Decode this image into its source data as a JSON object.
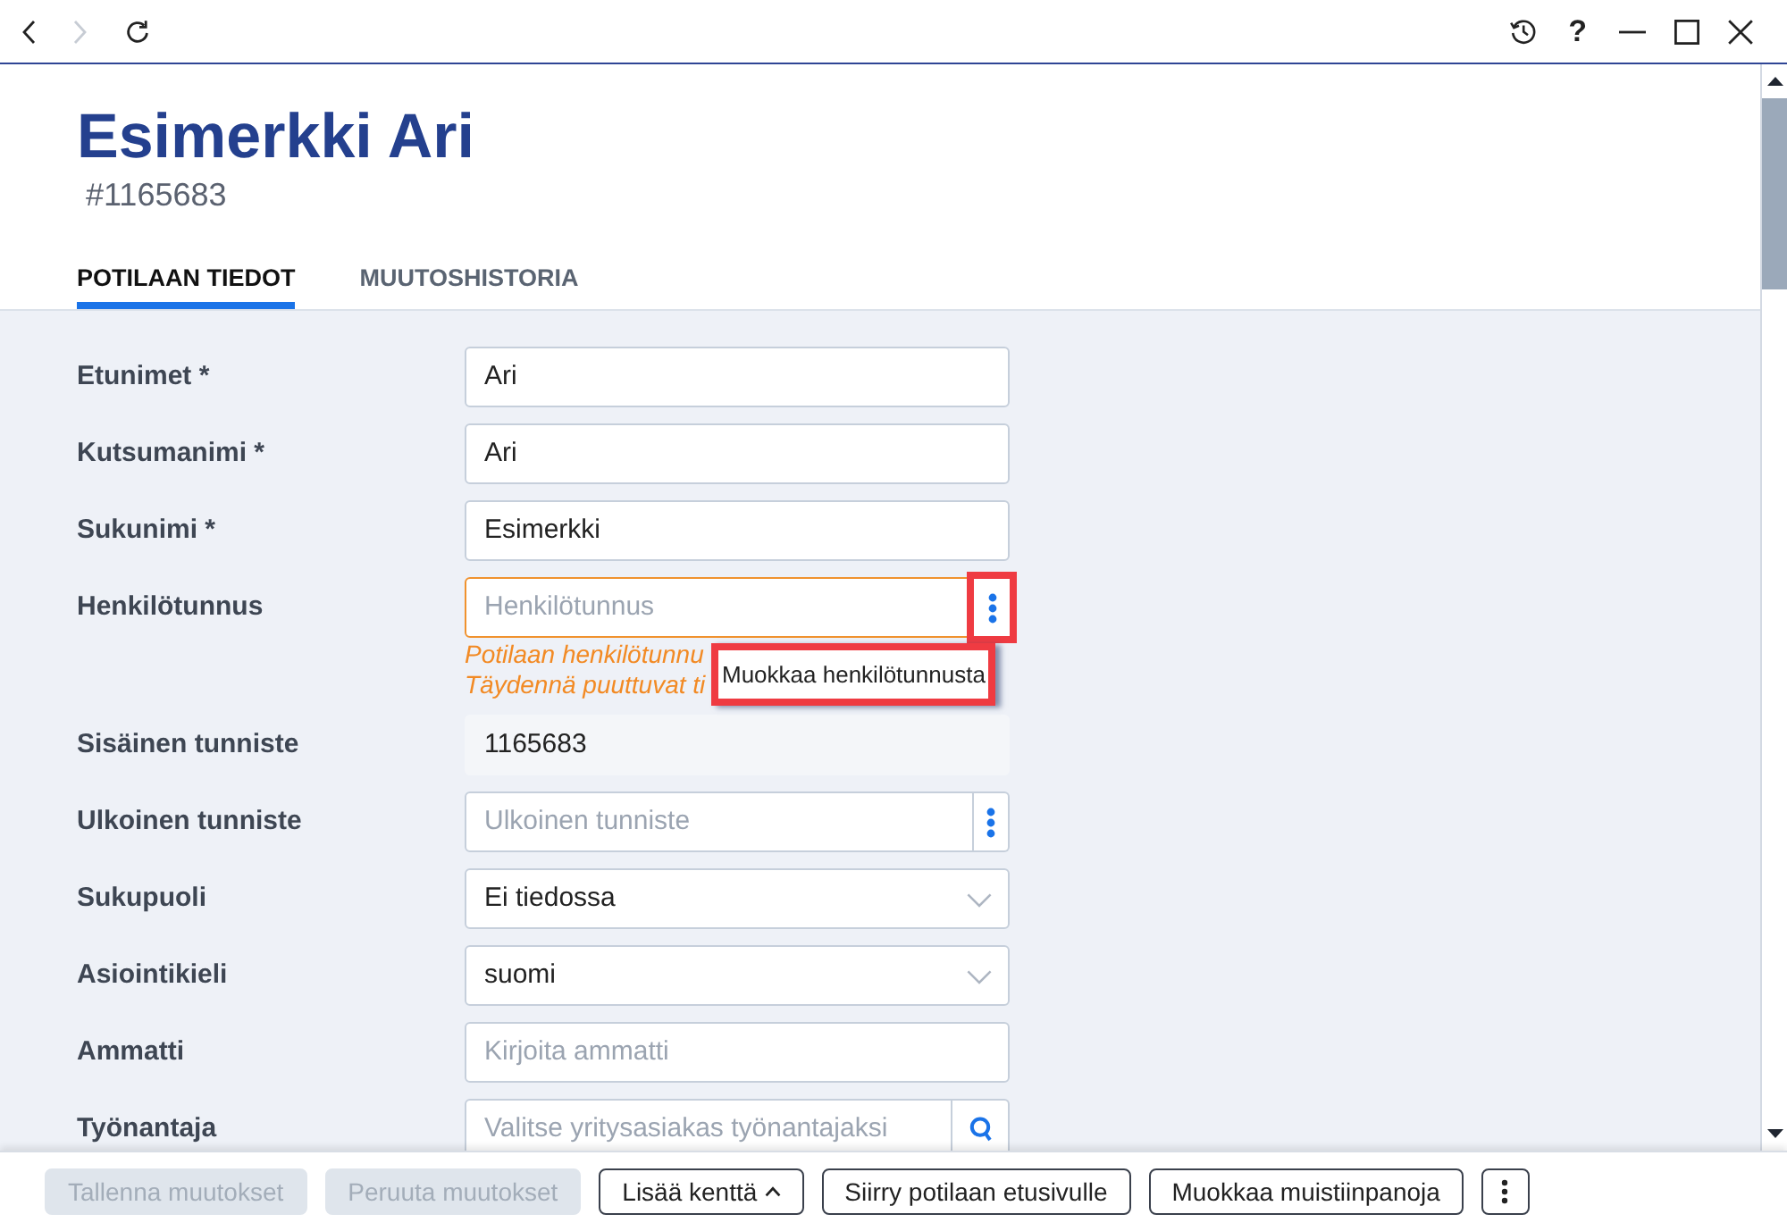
{
  "nav_buttons": [
    {
      "kind": "back",
      "disabled": false
    },
    {
      "kind": "forward",
      "disabled": true
    },
    {
      "kind": "reload",
      "disabled": false
    }
  ],
  "window_controls": [
    {
      "kind": "history"
    },
    {
      "kind": "help",
      "label": "?"
    },
    {
      "kind": "minimize"
    },
    {
      "kind": "maximize"
    },
    {
      "kind": "close"
    }
  ],
  "patient": {
    "name": "Esimerkki Ari",
    "number": "#1165683"
  },
  "tabs": [
    {
      "label": "POTILAAN TIEDOT",
      "selected": true
    },
    {
      "label": "MUUTOSHISTORIA",
      "selected": false
    }
  ],
  "form": {
    "fields": [
      {
        "label": "Etunimet *",
        "kind": "text",
        "value": "Ari"
      },
      {
        "label": "Kutsumanimi *",
        "kind": "text",
        "value": "Ari"
      },
      {
        "label": "Sukunimi *",
        "kind": "text",
        "value": "Esimerkki"
      },
      {
        "label": "Henkilötunnus",
        "kind": "menu",
        "placeholder": "Henkilötunnus",
        "warning": true,
        "messages": [
          "Potilaan henkilötunnu",
          "Täydennä puuttuvat ti"
        ],
        "menu_highlighted": true,
        "tooltip": {
          "text": "Muokkaa henkilötunnusta",
          "highlighted": true
        }
      },
      {
        "label": "Sisäinen tunniste",
        "kind": "readonly",
        "value": "1165683"
      },
      {
        "label": "Ulkoinen tunniste",
        "kind": "menu",
        "placeholder": "Ulkoinen tunniste",
        "warning": false,
        "menu_highlighted": false
      },
      {
        "label": "Sukupuoli",
        "kind": "select",
        "value": "Ei tiedossa"
      },
      {
        "label": "Asiointikieli",
        "kind": "select",
        "value": "suomi"
      },
      {
        "label": "Ammatti",
        "kind": "text",
        "placeholder": "Kirjoita ammatti"
      },
      {
        "label": "Työnantaja",
        "kind": "search",
        "placeholder": "Valitse yritysasiakas työnantajaksi"
      }
    ]
  },
  "actions": [
    {
      "kind": "button",
      "label": "Tallenna muutokset",
      "disabled": true
    },
    {
      "kind": "button",
      "label": "Peruuta muutokset",
      "disabled": true
    },
    {
      "kind": "dropup",
      "label": "Lisää kenttä",
      "disabled": false
    },
    {
      "kind": "button",
      "label": "Siirry potilaan etusivulle",
      "disabled": false
    },
    {
      "kind": "button",
      "label": "Muokkaa muistiinpanoja",
      "disabled": false
    },
    {
      "kind": "menu",
      "disabled": false
    }
  ]
}
